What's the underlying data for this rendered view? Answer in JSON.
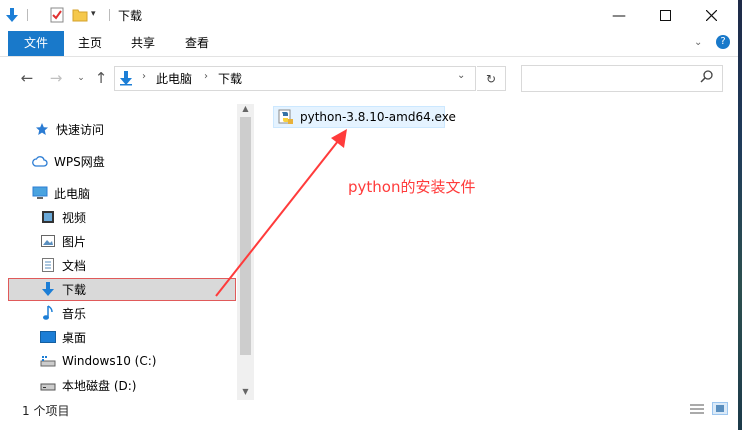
{
  "titlebar": {
    "title": "下载"
  },
  "ribbon": {
    "tabs": [
      "文件",
      "主页",
      "共享",
      "查看"
    ]
  },
  "address": {
    "segments": [
      "此电脑",
      "下载"
    ]
  },
  "nav": {
    "items": [
      {
        "label": "快速访问",
        "icon": "star-icon"
      },
      {
        "label": "WPS网盘",
        "icon": "cloud-icon"
      },
      {
        "label": "此电脑",
        "icon": "computer-icon"
      },
      {
        "label": "视频",
        "icon": "video-icon"
      },
      {
        "label": "图片",
        "icon": "picture-icon"
      },
      {
        "label": "文档",
        "icon": "document-icon"
      },
      {
        "label": "下载",
        "icon": "download-arrow-icon"
      },
      {
        "label": "音乐",
        "icon": "music-note-icon"
      },
      {
        "label": "桌面",
        "icon": "desktop-icon"
      },
      {
        "label": "Windows10 (C:)",
        "icon": "drive-icon"
      },
      {
        "label": "本地磁盘 (D:)",
        "icon": "drive-icon"
      }
    ]
  },
  "files": [
    {
      "name": "python-3.8.10-amd64.exe",
      "icon": "python-installer-icon"
    }
  ],
  "annotation": {
    "text": "python的安装文件",
    "color": "#ff3b3b"
  },
  "status": {
    "item_count": "1 个项目"
  },
  "colors": {
    "accent": "#1979ca",
    "selection": "#e5f3ff",
    "annotation": "#ff3b3b"
  }
}
